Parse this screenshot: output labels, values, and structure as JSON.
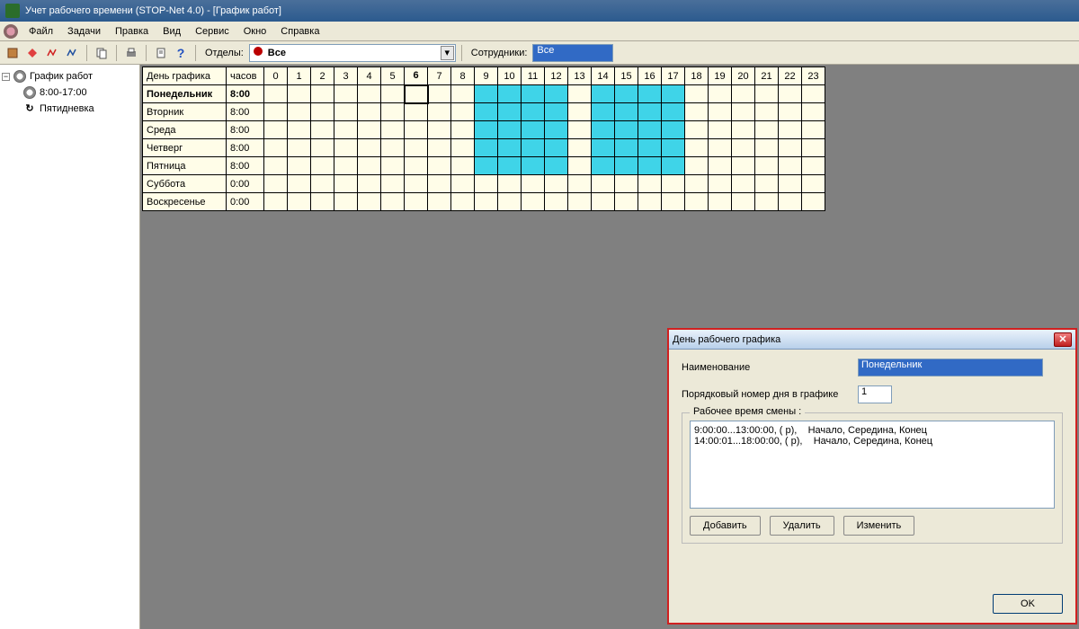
{
  "window": {
    "title": "Учет рабочего времени (STOP-Net 4.0) - [График работ]"
  },
  "menu": {
    "items": [
      "Файл",
      "Задачи",
      "Правка",
      "Вид",
      "Сервис",
      "Окно",
      "Справка"
    ]
  },
  "toolbar": {
    "dept_label": "Отделы:",
    "dept_value": "Все",
    "emp_label": "Сотрудники:",
    "emp_value": "Все"
  },
  "tree": {
    "root": "График работ",
    "items": [
      "8:00-17:00",
      "Пятидневка"
    ]
  },
  "schedule": {
    "day_header": "День графика",
    "hours_header": "часов",
    "hours": [
      "0",
      "1",
      "2",
      "3",
      "4",
      "5",
      "6",
      "7",
      "8",
      "9",
      "10",
      "11",
      "12",
      "13",
      "14",
      "15",
      "16",
      "17",
      "18",
      "19",
      "20",
      "21",
      "22",
      "23"
    ],
    "rows": [
      {
        "day": "Понедельник",
        "hrs": "8:00",
        "work": [
          [
            9,
            12
          ],
          [
            14,
            17
          ]
        ],
        "selected": true
      },
      {
        "day": "Вторник",
        "hrs": "8:00",
        "work": [
          [
            9,
            12
          ],
          [
            14,
            17
          ]
        ]
      },
      {
        "day": "Среда",
        "hrs": "8:00",
        "work": [
          [
            9,
            12
          ],
          [
            14,
            17
          ]
        ]
      },
      {
        "day": "Четверг",
        "hrs": "8:00",
        "work": [
          [
            9,
            12
          ],
          [
            14,
            17
          ]
        ]
      },
      {
        "day": "Пятница",
        "hrs": "8:00",
        "work": [
          [
            9,
            12
          ],
          [
            14,
            17
          ]
        ]
      },
      {
        "day": "Суббота",
        "hrs": "0:00",
        "work": []
      },
      {
        "day": "Воскресенье",
        "hrs": "0:00",
        "work": []
      }
    ]
  },
  "dialog": {
    "title": "День рабочего графика",
    "name_label": "Наименование",
    "name_value": "Понедельник",
    "order_label": "Порядковый номер дня в графике",
    "order_value": "1",
    "shift_legend": "Рабочее время смены :",
    "shifts": [
      "9:00:00...13:00:00, ( р),    Начало, Середина, Конец",
      "14:00:01...18:00:00, ( р),    Начало, Середина, Конец"
    ],
    "add_btn": "Добавить",
    "del_btn": "Удалить",
    "edit_btn": "Изменить",
    "ok_btn": "OK"
  }
}
